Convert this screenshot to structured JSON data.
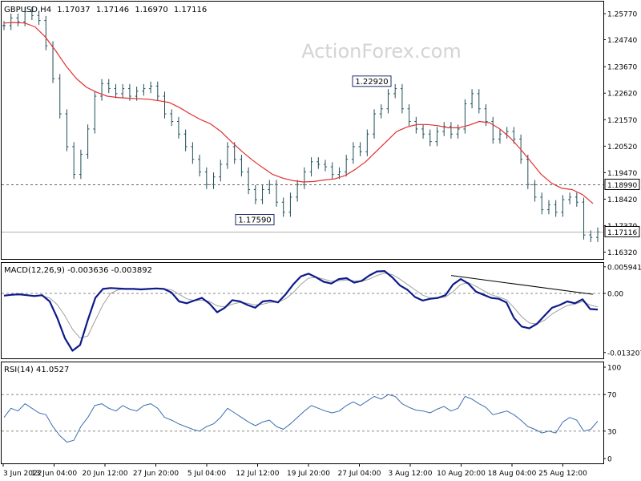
{
  "header": {
    "symbol": "GBPUSD,H4",
    "open": "1.17037",
    "high": "1.17146",
    "low": "1.16970",
    "close": "1.17116"
  },
  "watermark": "ActionForex.com",
  "colors": {
    "price_bars": "#1f4e5a",
    "sma": "#e03030",
    "macd": "#0d1a8a",
    "macd_signal": "#a0a0a0",
    "rsi": "#3a6fb0",
    "reference_lines": "#666666",
    "axis_text": "#000000",
    "background": "#ffffff"
  },
  "chart_data": [
    {
      "type": "candlestick",
      "name": "price",
      "ylim": [
        1.1605,
        1.2625
      ],
      "y_ticks": [
        "1.25770",
        "1.24740",
        "1.23670",
        "1.22620",
        "1.21570",
        "1.20520",
        "1.19470",
        "1.18420",
        "1.17370",
        "1.16320"
      ],
      "y_tick_values": [
        1.2577,
        1.2474,
        1.2367,
        1.2262,
        1.2157,
        1.2052,
        1.1947,
        1.1842,
        1.1737,
        1.1632
      ],
      "x_ticks": [
        "3 Jun 2022",
        "13 Jun 04:00",
        "20 Jun 12:00",
        "27 Jun 20:00",
        "5 Jul 04:00",
        "12 Jul 12:00",
        "19 Jul 20:00",
        "27 Jul 04:00",
        "3 Aug 12:00",
        "10 Aug 20:00",
        "18 Aug 04:00",
        "25 Aug 12:00"
      ],
      "series": [
        {
          "name": "close",
          "values": [
            1.253,
            1.256,
            1.2545,
            1.2585,
            1.257,
            1.255,
            1.245,
            1.232,
            1.218,
            1.205,
            1.194,
            1.202,
            1.212,
            1.225,
            1.23,
            1.228,
            1.226,
            1.228,
            1.225,
            1.227,
            1.228,
            1.229,
            1.225,
            1.218,
            1.215,
            1.21,
            1.205,
            1.2,
            1.195,
            1.19,
            1.193,
            1.198,
            1.205,
            1.2,
            1.195,
            1.188,
            1.184,
            1.188,
            1.19,
            1.183,
            1.179,
            1.185,
            1.19,
            1.195,
            1.199,
            1.198,
            1.197,
            1.194,
            1.195,
            1.2,
            1.205,
            1.203,
            1.21,
            1.218,
            1.22,
            1.226,
            1.228,
            1.22,
            1.215,
            1.212,
            1.21,
            1.207,
            1.211,
            1.213,
            1.21,
            1.212,
            1.222,
            1.226,
            1.22,
            1.215,
            1.208,
            1.21,
            1.211,
            1.208,
            1.2,
            1.19,
            1.185,
            1.18,
            1.182,
            1.179,
            1.184,
            1.185,
            1.183,
            1.17,
            1.169,
            1.1712
          ]
        },
        {
          "name": "SMA",
          "values": [
            1.254,
            1.2542,
            1.254,
            1.2525,
            1.2485,
            1.243,
            1.237,
            1.232,
            1.2285,
            1.2265,
            1.225,
            1.2245,
            1.2242,
            1.224,
            1.2238,
            1.2232,
            1.2225,
            1.2205,
            1.218,
            1.2158,
            1.214,
            1.211,
            1.207,
            1.2032,
            1.1998,
            1.1968,
            1.194,
            1.1925,
            1.1915,
            1.191,
            1.1912,
            1.1918,
            1.1922,
            1.1935,
            1.196,
            1.199,
            1.203,
            1.207,
            1.211,
            1.2128,
            1.2138,
            1.2138,
            1.2133,
            1.2125,
            1.2125,
            1.2135,
            1.215,
            1.2145,
            1.212,
            1.2085,
            1.204,
            1.199,
            1.194,
            1.1905,
            1.1885,
            1.188,
            1.186,
            1.1825
          ]
        }
      ],
      "reference_lines": [
        {
          "label": "1.18990",
          "value": 1.1899,
          "style": "dashed"
        },
        {
          "label": "1.17116",
          "value": 1.17116,
          "style": "solid"
        }
      ],
      "annotations": [
        {
          "label": "1.22920",
          "value": 1.2292
        },
        {
          "label": "1.17590",
          "value": 1.1759
        }
      ]
    },
    {
      "type": "line",
      "name": "MACD(12,26,9) -0.003636 -0.003892",
      "ylim": [
        -0.0145,
        0.0068
      ],
      "y_ticks": [
        "0.005941",
        "0.00",
        "-0.013207"
      ],
      "y_tick_values": [
        0.005941,
        0.0,
        -0.013207
      ],
      "series": [
        {
          "name": "macd",
          "values": [
            -0.0005,
            -0.0003,
            -0.0002,
            -0.0004,
            -0.0006,
            -0.0004,
            -0.0018,
            -0.0055,
            -0.01,
            -0.0128,
            -0.0115,
            -0.006,
            -0.001,
            0.001,
            0.0012,
            0.0011,
            0.001,
            0.001,
            0.0009,
            0.001,
            0.0011,
            0.001,
            0.0002,
            -0.0018,
            -0.0022,
            -0.0016,
            -0.001,
            -0.0023,
            -0.0042,
            -0.0032,
            -0.0015,
            -0.0018,
            -0.0026,
            -0.0032,
            -0.0018,
            -0.0016,
            -0.002,
            -0.0002,
            0.002,
            0.0038,
            0.0044,
            0.0036,
            0.0026,
            0.0022,
            0.0032,
            0.0034,
            0.0024,
            0.0028,
            0.004,
            0.0049,
            0.005,
            0.0036,
            0.0018,
            0.0008,
            -0.0008,
            -0.0016,
            -0.0012,
            -0.001,
            -0.0004,
            0.002,
            0.0032,
            0.0022,
            0.0004,
            -0.0003,
            -0.001,
            -0.0012,
            -0.002,
            -0.0055,
            -0.0074,
            -0.0078,
            -0.0068,
            -0.005,
            -0.0032,
            -0.0026,
            -0.0018,
            -0.0022,
            -0.0013,
            -0.0035,
            -0.0036
          ]
        },
        {
          "name": "signal",
          "values": [
            -0.0004,
            -0.0004,
            -0.0003,
            -0.0004,
            -0.0005,
            -0.0006,
            -0.001,
            -0.0025,
            -0.005,
            -0.008,
            -0.01,
            -0.0095,
            -0.006,
            -0.0025,
            0.0,
            0.0008,
            0.001,
            0.001,
            0.001,
            0.001,
            0.001,
            0.001,
            0.0008,
            -0.0002,
            -0.0012,
            -0.0016,
            -0.0015,
            -0.0018,
            -0.0028,
            -0.003,
            -0.0024,
            -0.002,
            -0.0022,
            -0.0026,
            -0.0024,
            -0.002,
            -0.0019,
            -0.0012,
            0.0002,
            0.002,
            0.0034,
            0.0036,
            0.0032,
            0.0027,
            0.0028,
            0.003,
            0.0028,
            0.0027,
            0.0032,
            0.004,
            0.0045,
            0.0042,
            0.0032,
            0.002,
            0.0008,
            -0.0004,
            -0.001,
            -0.001,
            -0.0008,
            0.0004,
            0.002,
            0.0024,
            0.0016,
            0.0006,
            -0.0003,
            -0.0008,
            -0.0014,
            -0.0032,
            -0.0052,
            -0.0066,
            -0.0068,
            -0.006,
            -0.0046,
            -0.0036,
            -0.0027,
            -0.0024,
            -0.0018,
            -0.0026,
            -0.003
          ]
        }
      ],
      "trendline": [
        0.004,
        -0.0002
      ]
    },
    {
      "type": "line",
      "name": "RSI(14) 41.0527",
      "ylim": [
        0,
        100
      ],
      "y_ticks": [
        "100",
        "70",
        "30",
        "0"
      ],
      "y_tick_values": [
        100,
        70,
        30,
        0
      ],
      "reference_lines": [
        70,
        30
      ],
      "series": [
        {
          "name": "rsi",
          "values": [
            45,
            55,
            52,
            60,
            55,
            50,
            48,
            35,
            25,
            18,
            20,
            35,
            45,
            58,
            60,
            55,
            52,
            58,
            54,
            52,
            58,
            60,
            55,
            45,
            42,
            38,
            35,
            32,
            30,
            35,
            38,
            45,
            55,
            50,
            45,
            40,
            36,
            40,
            42,
            35,
            32,
            38,
            45,
            52,
            58,
            55,
            52,
            50,
            52,
            58,
            62,
            58,
            63,
            68,
            65,
            70,
            68,
            60,
            56,
            53,
            52,
            50,
            54,
            57,
            52,
            55,
            68,
            65,
            60,
            56,
            48,
            50,
            52,
            48,
            42,
            35,
            32,
            28,
            30,
            28,
            40,
            45,
            42,
            30,
            32,
            41
          ]
        }
      ]
    }
  ]
}
